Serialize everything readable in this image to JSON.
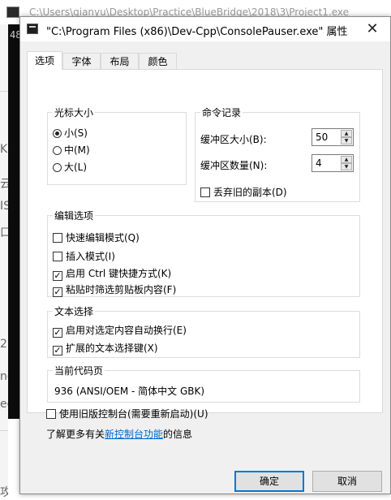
{
  "background": {
    "title_path": "C:\\Users\\qianyu\\Desktop\\Practice\\BlueBridge\\2018\\3\\Project1.exe",
    "console_text": "48"
  },
  "dialog": {
    "title": "\"C:\\Program Files (x86)\\Dev-Cpp\\ConsolePauser.exe\" 属性",
    "close_glyph": "✕",
    "tabs": [
      "选项",
      "字体",
      "布局",
      "颜色"
    ],
    "active_tab": 0,
    "cursor_size": {
      "label": "光标大小",
      "options": [
        "小(S)",
        "中(M)",
        "大(L)"
      ],
      "selected": 0
    },
    "history": {
      "label": "命令记录",
      "buffer_size_label": "缓冲区大小(B):",
      "buffer_size_value": "50",
      "buffer_count_label": "缓冲区数量(N):",
      "buffer_count_value": "4",
      "discard_old_label": "丢弃旧的副本(D)",
      "discard_old_checked": false
    },
    "edit_options": {
      "label": "编辑选项",
      "items": [
        {
          "label": "快速编辑模式(Q)",
          "checked": false
        },
        {
          "label": "插入模式(I)",
          "checked": false
        },
        {
          "label": "启用 Ctrl 键快捷方式(K)",
          "checked": true
        },
        {
          "label": "粘贴时筛选剪贴板内容(F)",
          "checked": true
        }
      ]
    },
    "text_selection": {
      "label": "文本选择",
      "items": [
        {
          "label": "启用对选定内容自动换行(E)",
          "checked": true
        },
        {
          "label": "扩展的文本选择键(X)",
          "checked": true
        }
      ]
    },
    "codepage": {
      "label": "当前代码页",
      "value": "936   (ANSI/OEM - 简体中文 GBK)"
    },
    "legacy_console": {
      "label": "使用旧版控制台(需要重新启动)(U)",
      "checked": false
    },
    "learn_more": {
      "prefix": "了解更多有关",
      "link": "新控制台功能",
      "suffix": "的信息"
    },
    "ok_label": "确定",
    "cancel_label": "取消",
    "check_glyph": "✓",
    "accent_color": "#0078d7",
    "link_color": "#0066cc"
  }
}
